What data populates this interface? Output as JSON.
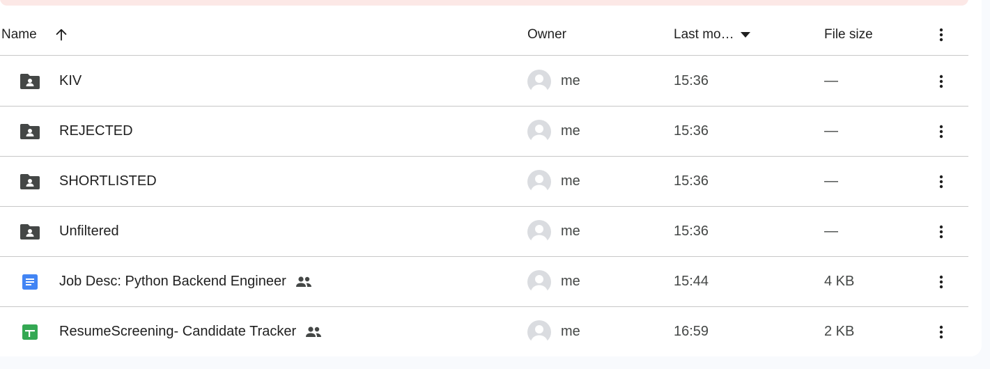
{
  "header": {
    "name": "Name",
    "owner": "Owner",
    "last_modified": "Last mo…",
    "file_size": "File size"
  },
  "colors": {
    "folder": "#444746",
    "docs": "#4285f4",
    "sheets": "#34a853",
    "banner": "#fce8e6"
  },
  "rows": [
    {
      "icon": "shared-folder-icon",
      "name": "KIV",
      "shared": false,
      "owner": "me",
      "modified": "15:36",
      "size": "—"
    },
    {
      "icon": "shared-folder-icon",
      "name": "REJECTED",
      "shared": false,
      "owner": "me",
      "modified": "15:36",
      "size": "—"
    },
    {
      "icon": "shared-folder-icon",
      "name": "SHORTLISTED",
      "shared": false,
      "owner": "me",
      "modified": "15:36",
      "size": "—"
    },
    {
      "icon": "shared-folder-icon",
      "name": "Unfiltered",
      "shared": false,
      "owner": "me",
      "modified": "15:36",
      "size": "—"
    },
    {
      "icon": "google-docs-icon",
      "name": "Job Desc: Python Backend Engineer",
      "shared": true,
      "owner": "me",
      "modified": "15:44",
      "size": "4 KB"
    },
    {
      "icon": "google-sheets-icon",
      "name": "ResumeScreening- Candidate Tracker",
      "shared": true,
      "owner": "me",
      "modified": "16:59",
      "size": "2 KB"
    }
  ]
}
